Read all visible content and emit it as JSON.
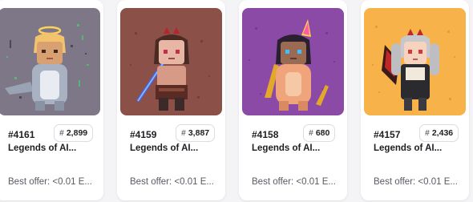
{
  "cards": [
    {
      "id": "#4161",
      "rank_label": "#",
      "rank": "2,899",
      "name": "Legends of AI...",
      "offer": "Best offer: <0.01 E...",
      "bg_color": "#7d7787",
      "character": "halo-shark-costume"
    },
    {
      "id": "#4159",
      "rank_label": "#",
      "rank": "3,887",
      "name": "Legends of AI...",
      "offer": "Best offer: <0.01 E...",
      "bg_color": "#8b5048",
      "character": "blue-sword-warrior"
    },
    {
      "id": "#4158",
      "rank_label": "#",
      "rank": "680",
      "name": "Legends of AI...",
      "offer": "Best offer: <0.01 E...",
      "bg_color": "#8a4aa6",
      "character": "unicorn-costume-golden-blade"
    },
    {
      "id": "#4157",
      "rank_label": "#",
      "rank": "2,436",
      "name": "Legends of AI...",
      "offer": "Best offer: <0.01 E...",
      "bg_color": "#f7b24a",
      "character": "silver-twin-tail-horns"
    }
  ]
}
